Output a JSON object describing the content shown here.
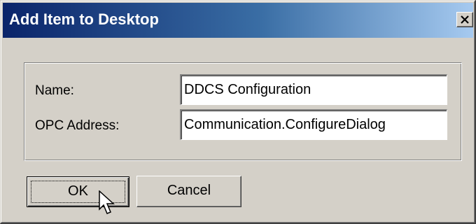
{
  "window": {
    "title": "Add Item to Desktop",
    "close_icon": "close-x-icon"
  },
  "form": {
    "name_label": "Name:",
    "name_value": "DDCS Configuration",
    "opc_label": "OPC Address:",
    "opc_value": "Communication.ConfigureDialog"
  },
  "buttons": {
    "ok_label": "OK",
    "cancel_label": "Cancel"
  },
  "colors": {
    "titlebar_start": "#0a246a",
    "titlebar_end": "#a6caf0",
    "dialog_face": "#d4d0c8",
    "field_background": "#ffffff"
  },
  "icons": {
    "cursor": "arrow-pointer-icon"
  }
}
